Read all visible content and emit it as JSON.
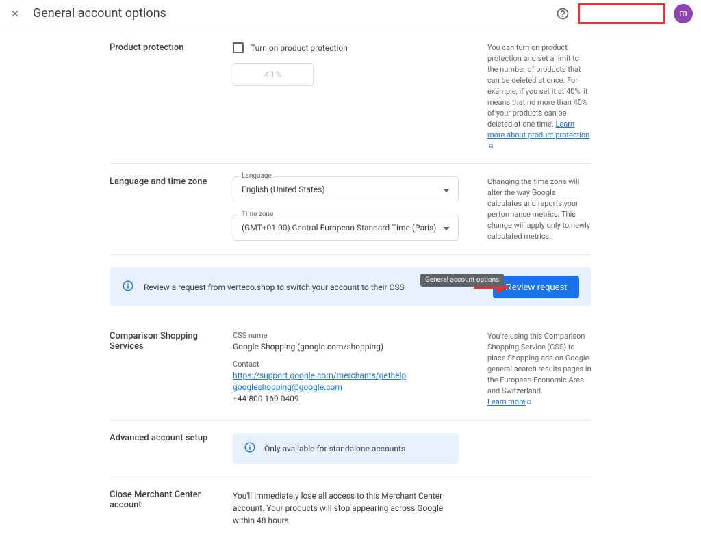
{
  "header": {
    "title": "General account options",
    "avatar_letter": "m"
  },
  "product_protection": {
    "section_label": "Product protection",
    "checkbox_label": "Turn on product protection",
    "percent_value": "40 %",
    "side_text": "You can turn on product protection and set a limit to the number of products that can be deleted at once. For example, if you set it at 40%, it means that no more than 40% of your products can be deleted at one time.",
    "learn_more": "Learn more about product protection"
  },
  "language_timezone": {
    "section_label": "Language and time zone",
    "language_label": "Language",
    "language_value": "English (United States)",
    "timezone_label": "Time zone",
    "timezone_value": "(GMT+01:00) Central European Standard Time (Paris)",
    "side_text": "Changing the time zone will alter the way Google calculates and reports your performance metrics. This change will apply only to newly calculated metrics."
  },
  "banner": {
    "message": "Review a request from verteco.shop to switch your account to their CSS",
    "button_label": "Review request"
  },
  "css": {
    "section_label": "Comparison Shopping Services",
    "name_heading": "CSS name",
    "name_value": "Google Shopping (google.com/shopping)",
    "contact_heading": "Contact",
    "contact_url": "https://support.google.com/merchants/gethelp",
    "contact_email": "googleshopping@google.com",
    "contact_phone": "+44 800 169 0409",
    "side_text": "You're using this Comparison Shopping Service (CSS) to place Shopping ads on Google general search results pages in the European Economic Area and Switzerland.",
    "learn_more": "Learn more"
  },
  "advanced": {
    "section_label": "Advanced account setup",
    "info_text": "Only available for standalone accounts"
  },
  "close_account": {
    "section_label": "Close Merchant Center account",
    "text": "You'll immediately lose all access to this Merchant Center account. Your products will stop appearing across Google within 48 hours."
  },
  "tooltip": {
    "text": "General account options"
  }
}
